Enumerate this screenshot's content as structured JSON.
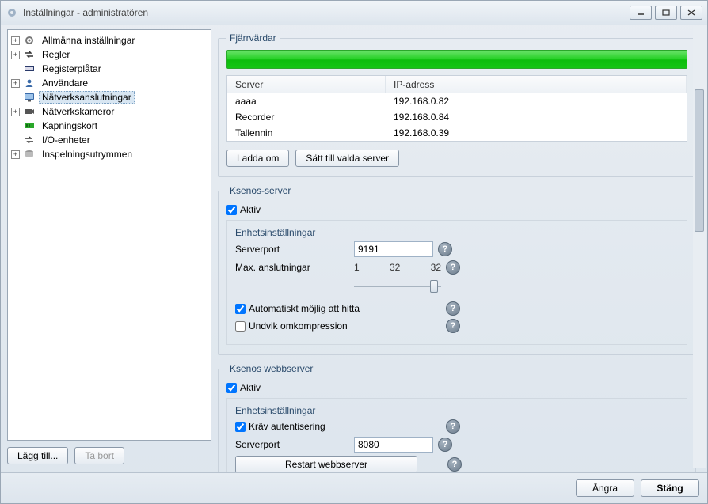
{
  "window": {
    "title": "Inställningar - administratören"
  },
  "tree": {
    "items": [
      {
        "label": "Allmänna inställningar",
        "expandable": true,
        "icon": "gear"
      },
      {
        "label": "Regler",
        "expandable": true,
        "icon": "arrows"
      },
      {
        "label": "Registerplåtar",
        "expandable": false,
        "icon": "plate",
        "indent": true
      },
      {
        "label": "Användare",
        "expandable": true,
        "icon": "user"
      },
      {
        "label": "Nätverksanslutningar",
        "expandable": false,
        "icon": "monitor",
        "indent": true,
        "selected": true
      },
      {
        "label": "Nätverkskameror",
        "expandable": true,
        "icon": "camera"
      },
      {
        "label": "Kapningskort",
        "expandable": false,
        "icon": "card",
        "indent": true
      },
      {
        "label": "I/O-enheter",
        "expandable": false,
        "icon": "io",
        "indent": true
      },
      {
        "label": "Inspelningsutrymmen",
        "expandable": true,
        "icon": "disk"
      }
    ]
  },
  "left_buttons": {
    "add": "Lägg till...",
    "remove": "Ta bort"
  },
  "remote": {
    "legend": "Fjärrvärdar",
    "headers": {
      "server": "Server",
      "ip": "IP-adress"
    },
    "rows": [
      {
        "server": "aaaa",
        "ip": "192.168.0.82"
      },
      {
        "server": "Recorder",
        "ip": "192.168.0.84"
      },
      {
        "server": "Tallennin",
        "ip": "192.168.0.39"
      }
    ],
    "reload": "Ladda om",
    "set_selected": "Sätt till valda server"
  },
  "ksenos_server": {
    "legend": "Ksenos-server",
    "active_label": "Aktiv",
    "active_checked": true,
    "unit_legend": "Enhetsinställningar",
    "port_label": "Serverport",
    "port_value": "9191",
    "max_label": "Max. anslutningar",
    "max_min": "1",
    "max_mid": "32",
    "max_val": "32",
    "auto_label": "Automatiskt möjlig att hitta",
    "auto_checked": true,
    "recomp_label": "Undvik omkompression",
    "recomp_checked": false
  },
  "ksenos_web": {
    "legend": "Ksenos webbserver",
    "active_label": "Aktiv",
    "active_checked": true,
    "unit_legend": "Enhetsinställningar",
    "auth_label": "Kräv autentisering",
    "auth_checked": true,
    "port_label": "Serverport",
    "port_value": "8080",
    "restart": "Restart webbserver"
  },
  "footer": {
    "undo": "Ångra",
    "close": "Stäng"
  }
}
